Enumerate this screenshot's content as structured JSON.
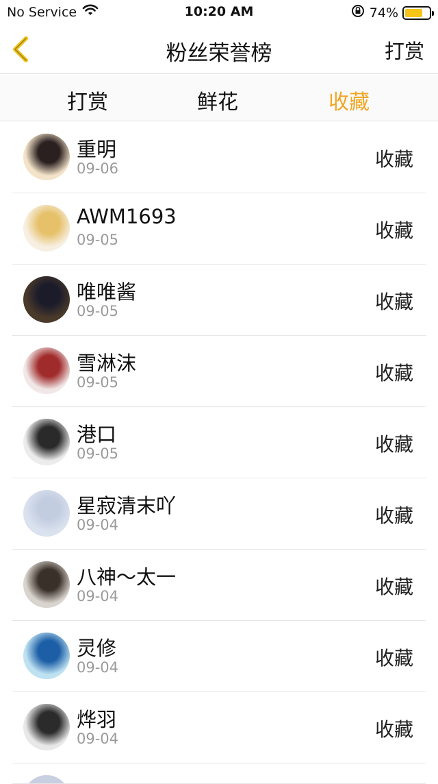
{
  "status_bar": {
    "carrier": "No Service",
    "time": "10:20 AM",
    "battery_percent": "74%",
    "battery_level": 0.74,
    "battery_color": "#f5c518"
  },
  "navbar": {
    "title": "粉丝荣誉榜",
    "action_label": "打赏",
    "back_icon": "chevron-left-icon",
    "back_icon_color": "#f0c419"
  },
  "tabs": [
    {
      "label": "打赏",
      "active": false
    },
    {
      "label": "鲜花",
      "active": false
    },
    {
      "label": "收藏",
      "active": true
    }
  ],
  "accent_color": "#f0a623",
  "fans": [
    {
      "name": "重明",
      "date": "09-06",
      "action": "收藏",
      "avatar_colors": [
        "#f3e3c8",
        "#2b2020"
      ]
    },
    {
      "name": "AWM1693",
      "date": "09-05",
      "action": "收藏",
      "avatar_colors": [
        "#f7efe2",
        "#e6c16a"
      ]
    },
    {
      "name": "唯唯酱",
      "date": "09-05",
      "action": "收藏",
      "avatar_colors": [
        "#4a3a2a",
        "#1b1b2a"
      ]
    },
    {
      "name": "雪淋沫",
      "date": "09-05",
      "action": "收藏",
      "avatar_colors": [
        "#f1e7e7",
        "#a02b2b"
      ]
    },
    {
      "name": "港口",
      "date": "09-05",
      "action": "收藏",
      "avatar_colors": [
        "#ececec",
        "#2a2a2a"
      ]
    },
    {
      "name": "星寂清末吖",
      "date": "09-04",
      "action": "收藏",
      "avatar_colors": [
        "#dbe2ef",
        "#c2cde0"
      ]
    },
    {
      "name": "八神～太一",
      "date": "09-04",
      "action": "收藏",
      "avatar_colors": [
        "#d9d4cd",
        "#3a302a"
      ]
    },
    {
      "name": "灵修",
      "date": "09-04",
      "action": "收藏",
      "avatar_colors": [
        "#bfe2f2",
        "#1d5fa6"
      ]
    },
    {
      "name": "烨羽",
      "date": "09-04",
      "action": "收藏",
      "avatar_colors": [
        "#e8e8e8",
        "#2b2b2b"
      ]
    }
  ]
}
